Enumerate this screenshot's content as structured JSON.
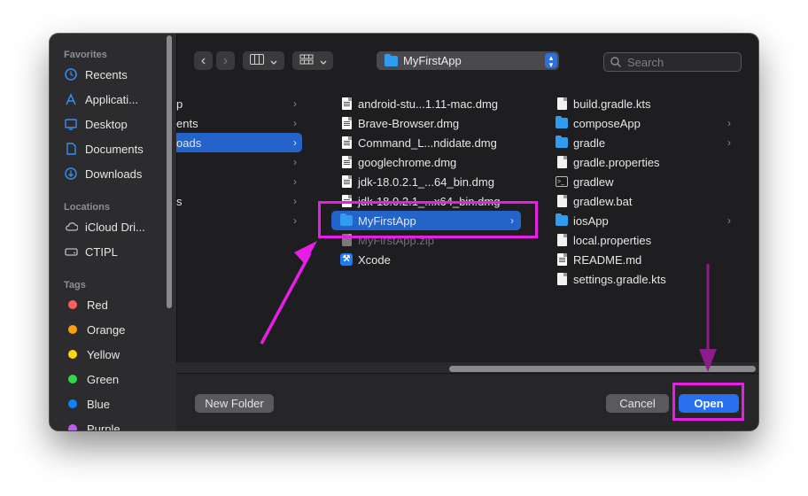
{
  "sidebar": {
    "favorites_heading": "Favorites",
    "favorites": [
      {
        "label": "Recents",
        "icon": "clock-icon"
      },
      {
        "label": "Applicati...",
        "icon": "applications-icon"
      },
      {
        "label": "Desktop",
        "icon": "desktop-icon"
      },
      {
        "label": "Documents",
        "icon": "document-icon"
      },
      {
        "label": "Downloads",
        "icon": "download-icon"
      }
    ],
    "locations_heading": "Locations",
    "locations": [
      {
        "label": "iCloud Dri...",
        "icon": "cloud-icon"
      },
      {
        "label": "CTIPL",
        "icon": "drive-icon"
      }
    ],
    "tags_heading": "Tags",
    "tags": [
      {
        "label": "Red",
        "color": "#ff5f57"
      },
      {
        "label": "Orange",
        "color": "#ff9f0a"
      },
      {
        "label": "Yellow",
        "color": "#ffd60a"
      },
      {
        "label": "Green",
        "color": "#32d74b"
      },
      {
        "label": "Blue",
        "color": "#0a84ff"
      },
      {
        "label": "Purple",
        "color": "#bf5af2"
      }
    ]
  },
  "toolbar": {
    "back_icon": "‹",
    "forward_icon": "›",
    "path_popup": "MyFirstApp",
    "search_placeholder": "Search"
  },
  "column1": [
    {
      "label": "p",
      "selected": false
    },
    {
      "label": "ents",
      "selected": false
    },
    {
      "label": "oads",
      "selected": true
    },
    {
      "label": "",
      "selected": false
    },
    {
      "label": "",
      "selected": false
    },
    {
      "label": "s",
      "selected": false
    },
    {
      "label": "",
      "selected": false
    }
  ],
  "column2": [
    {
      "label": "android-stu...1.11-mac.dmg",
      "icon": "document-icon"
    },
    {
      "label": "Brave-Browser.dmg",
      "icon": "document-icon"
    },
    {
      "label": "Command_L...ndidate.dmg",
      "icon": "document-icon"
    },
    {
      "label": "googlechrome.dmg",
      "icon": "document-icon"
    },
    {
      "label": "jdk-18.0.2.1_...64_bin.dmg",
      "icon": "document-icon"
    },
    {
      "label": "jdk-18.0.2.1_...x64_bin.dmg",
      "icon": "document-icon"
    },
    {
      "label": "MyFirstApp",
      "icon": "folder-icon",
      "selected": true
    },
    {
      "label": "MyFirstApp.zip",
      "icon": "zip-icon",
      "dimmed": true
    },
    {
      "label": "Xcode",
      "icon": "xcode-icon"
    }
  ],
  "column3": [
    {
      "label": "build.gradle.kts",
      "icon": "document-icon"
    },
    {
      "label": "composeApp",
      "icon": "folder-icon",
      "has_children": true
    },
    {
      "label": "gradle",
      "icon": "folder-icon",
      "has_children": true
    },
    {
      "label": "gradle.properties",
      "icon": "document-icon"
    },
    {
      "label": "gradlew",
      "icon": "terminal-icon"
    },
    {
      "label": "gradlew.bat",
      "icon": "document-icon"
    },
    {
      "label": "iosApp",
      "icon": "folder-icon",
      "has_children": true
    },
    {
      "label": "local.properties",
      "icon": "document-icon"
    },
    {
      "label": "README.md",
      "icon": "document-icon"
    },
    {
      "label": "settings.gradle.kts",
      "icon": "document-icon"
    }
  ],
  "footer": {
    "new_folder": "New Folder",
    "cancel": "Cancel",
    "open": "Open"
  },
  "annotation_color": "#e61ee6",
  "accent_color": "#2463c9"
}
